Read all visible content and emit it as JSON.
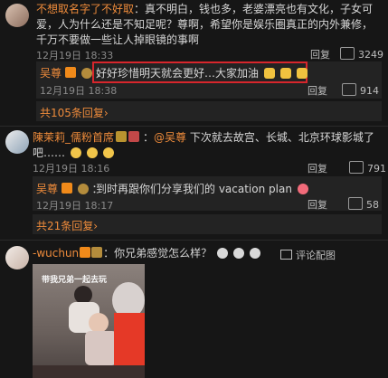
{
  "comments": [
    {
      "user": "不想取名字了不好取",
      "text": "：真不明白，钱也多，老婆漂亮也有文化，子女可爱，人为什么还是不知足呢？尊啊，希望你是娱乐圈真正的内外兼修，千万不要做一些让人掉眼镜的事啊",
      "time": "12月19日 18:33",
      "reply": "回复",
      "likes": "3249",
      "sub_reply": {
        "user": "吴尊",
        "text": "好好珍惜明天就会更好…大家加油",
        "time": "12月19日 18:38",
        "reply": "回复",
        "likes": "914"
      },
      "more": "共105条回复"
    },
    {
      "user": "陳茉莉_儒粉首席",
      "mention": "@吴尊",
      "text": "下次就去故宫、长城、北京环球影城了吧……",
      "time": "12月19日 18:16",
      "reply": "回复",
      "likes": "791",
      "sub_reply": {
        "user": "吴尊",
        "text": "到时再跟你们分享我们的 vacation plan",
        "time": "12月19日 18:17",
        "reply": "回复",
        "likes": "58"
      },
      "more": "共21条回复"
    },
    {
      "user": "-wuchun",
      "text": "：你兄弟感觉怎么样？",
      "action": "评论配图",
      "photo_caption": "带我兄弟一起去玩"
    }
  ],
  "colors": {
    "accent": "#ee8b3b",
    "highlight": "#d7262c"
  }
}
